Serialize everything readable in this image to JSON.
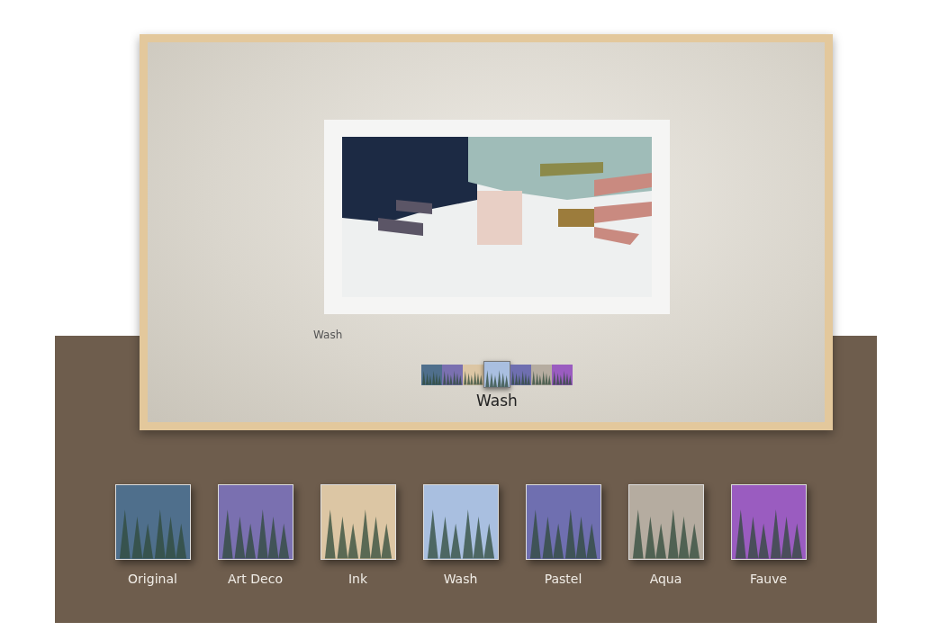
{
  "tv_screen": {
    "artwork_caption": "Wash",
    "filter_strip": {
      "items": [
        {
          "color": "#4f6f8c",
          "selected": false
        },
        {
          "color": "#7a70b0",
          "selected": false
        },
        {
          "color": "#dcc6a4",
          "selected": false
        },
        {
          "color": "#a9bfe0",
          "selected": true
        },
        {
          "color": "#6f6fb0",
          "selected": false
        },
        {
          "color": "#b5aca0",
          "selected": false
        },
        {
          "color": "#9a5cc0",
          "selected": false
        }
      ],
      "label": "Wash"
    }
  },
  "styles": [
    {
      "name": "Original",
      "color": "#4f6f8c"
    },
    {
      "name": "Art Deco",
      "color": "#7a70b0"
    },
    {
      "name": "Ink",
      "color": "#dcc6a4"
    },
    {
      "name": "Wash",
      "color": "#a9bfe0"
    },
    {
      "name": "Pastel",
      "color": "#6f6fb0"
    },
    {
      "name": "Aqua",
      "color": "#b5aca0"
    },
    {
      "name": "Fauve",
      "color": "#9a5cc0"
    }
  ]
}
